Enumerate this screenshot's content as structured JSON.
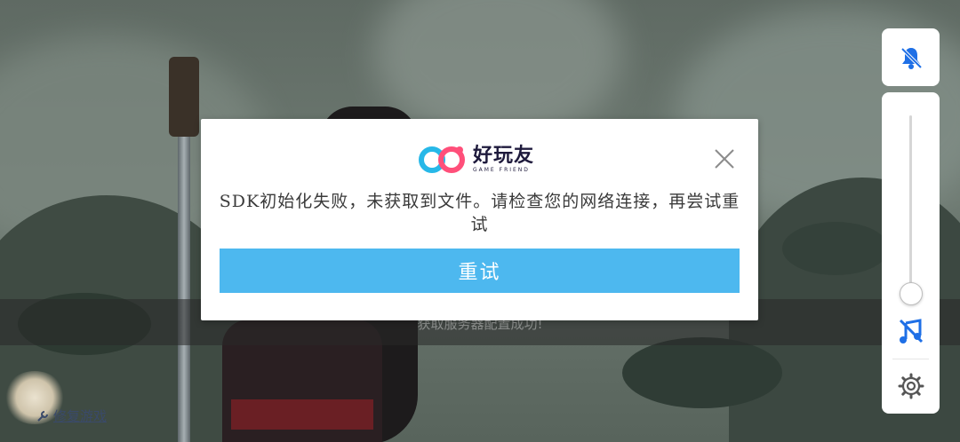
{
  "background": {
    "notice_text": "获取服务器配置成功!",
    "repair_link_label": "修复游戏"
  },
  "dialog": {
    "logo_text": "好玩友",
    "logo_subtext": "GAME FRIEND",
    "message": "SDK初始化失败，未获取到文件。请检查您的网络连接，再尝试重试",
    "retry_label": "重试",
    "close_icon": "close-icon"
  },
  "side_controls": {
    "bell_icon": "bell-muted-icon",
    "volume_level": 0.1,
    "music_icon": "music-off-icon",
    "settings_icon": "gear-icon"
  },
  "colors": {
    "accent": "#4db8ef",
    "icon_blue": "#1e6fe6",
    "logo_cyan": "#27b8e8",
    "logo_pink": "#ff4f7a"
  }
}
